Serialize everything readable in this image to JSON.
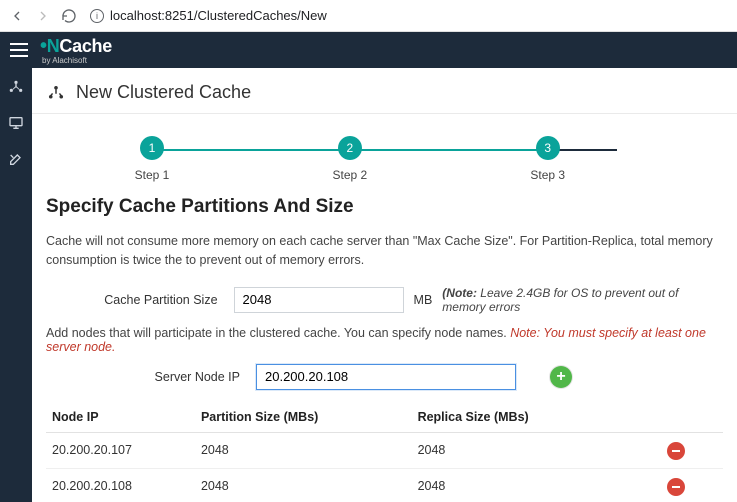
{
  "browser": {
    "url": "localhost:8251/ClusteredCaches/New"
  },
  "brand": {
    "name": "NCache",
    "by": "by Alachisoft"
  },
  "page": {
    "title": "New Clustered Cache",
    "section_title": "Specify Cache Partitions And Size",
    "description": "Cache will not consume more memory on each cache server than \"Max Cache Size\". For Partition-Replica, total memory consumption is twice the to prevent out of memory errors.",
    "nodes_description": "Add nodes that will participate in the clustered cache. You can specify node names. ",
    "nodes_note": "Note: You must specify at least one server node."
  },
  "steps": [
    {
      "num": "1",
      "label": "Step 1"
    },
    {
      "num": "2",
      "label": "Step 2"
    },
    {
      "num": "3",
      "label": "Step 3"
    }
  ],
  "form": {
    "partition_label": "Cache Partition Size",
    "partition_value": "2048",
    "partition_unit": "MB",
    "partition_hint_prefix": "(Note:",
    "partition_hint": " Leave 2.4GB for OS to prevent out of memory errors",
    "server_label": "Server Node IP",
    "server_value": "20.200.20.108"
  },
  "table": {
    "cols": [
      "Node IP",
      "Partition Size (MBs)",
      "Replica Size (MBs)",
      ""
    ],
    "rows": [
      {
        "ip": "20.200.20.107",
        "partition": "2048",
        "replica": "2048"
      },
      {
        "ip": "20.200.20.108",
        "partition": "2048",
        "replica": "2048"
      }
    ]
  }
}
